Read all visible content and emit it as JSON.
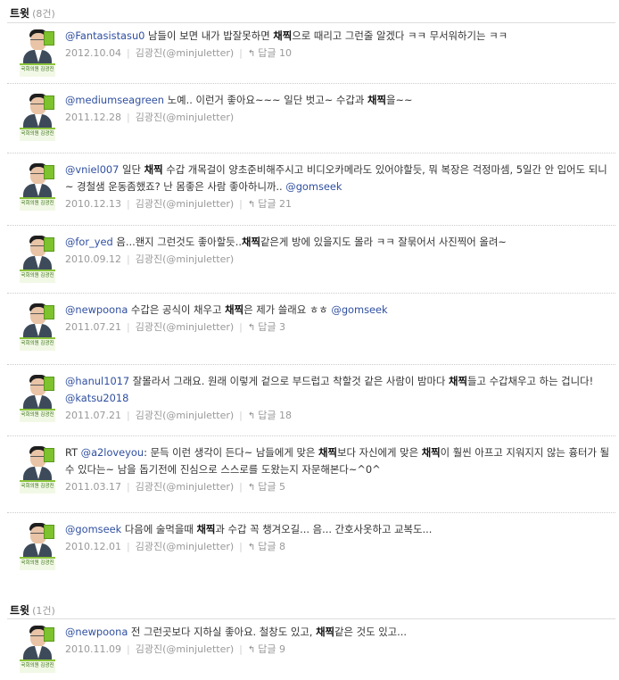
{
  "sections": [
    {
      "title": "트윗",
      "count": "(8건)",
      "tweets": [
        {
          "pre": "",
          "mention": "@Fantasistasu0",
          "p1": " 남들이 보면 내가 밥잘못하면 ",
          "kw1": "채찍",
          "p2": "으로 때리고 그런줄 알겠다 ㅋㅋ 무서워하기는 ㅋㅋ",
          "kw2": "",
          "p3": "",
          "mention2": "",
          "date": "2012.10.04",
          "author": "김광진(@minjuletter)",
          "reply": "답글 10"
        },
        {
          "pre": "",
          "mention": "@mediumseagreen",
          "p1": " 노예.. 이런거 좋아요~~~ 일단 벗고~ 수갑과 ",
          "kw1": "채찍",
          "p2": "을~~",
          "kw2": "",
          "p3": "",
          "mention2": "",
          "date": "2011.12.28",
          "author": "김광진(@minjuletter)",
          "reply": ""
        },
        {
          "pre": "",
          "mention": "@vniel007",
          "p1": " 일단 ",
          "kw1": "채찍",
          "p2": " 수갑 개목걸이 양초준비해주시고 비디오카메라도 있어야할듯, 뭐 복장은 걱정마셈, 5일간 안 입어도 되니~ 경철샘 운동좀했죠? 난 몸좋은 사람 좋아하니까.. ",
          "kw2": "",
          "p3": "",
          "mention2": "@gomseek",
          "date": "2010.12.13",
          "author": "김광진(@minjuletter)",
          "reply": "답글 21"
        },
        {
          "pre": "",
          "mention": "@for_yed",
          "p1": " 음...왠지 그런것도 좋아할듯..",
          "kw1": "채찍",
          "p2": "같은게 방에 있을지도 몰라 ㅋㅋ 잘묶어서 사진찍어 올려~",
          "kw2": "",
          "p3": "",
          "mention2": "",
          "date": "2010.09.12",
          "author": "김광진(@minjuletter)",
          "reply": ""
        },
        {
          "pre": "",
          "mention": "@newpoona",
          "p1": " 수갑은 공식이 채우고 ",
          "kw1": "채찍",
          "p2": "은 제가 쓸래요 ㅎㅎ ",
          "kw2": "",
          "p3": "",
          "mention2": "@gomseek",
          "date": "2011.07.21",
          "author": "김광진(@minjuletter)",
          "reply": "답글 3"
        },
        {
          "pre": "",
          "mention": "@hanul1017",
          "p1": " 잘몰라서 그래요. 원래 이렇게 겉으로 부드럽고 착할것 같은 사람이 밤마다 ",
          "kw1": "채찍",
          "p2": "들고 수갑채우고 하는 겁니다! ",
          "kw2": "",
          "p3": "",
          "mention2": "@katsu2018",
          "date": "2011.07.21",
          "author": "김광진(@minjuletter)",
          "reply": "답글 18"
        },
        {
          "pre": "RT ",
          "mention": "@a2loveyou",
          "p1": ": 문득 이런 생각이 든다~ 남들에게 맞은 ",
          "kw1": "채찍",
          "p2": "보다 자신에게 맞은 ",
          "kw2": "채찍",
          "p3": "이 훨씬 아프고 지워지지 않는 흉터가 될 수 있다는~ 남을 돕기전에 진심으로 스스로를 도왔는지 자문해본다~^0^",
          "mention2": "",
          "date": "2011.03.17",
          "author": "김광진(@minjuletter)",
          "reply": "답글 5"
        },
        {
          "pre": "",
          "mention": "@gomseek",
          "p1": " 다음에 술먹을때 ",
          "kw1": "채찍",
          "p2": "과 수갑 꼭 챙겨오길... 음... 간호사옷하고 교복도...",
          "kw2": "",
          "p3": "",
          "mention2": "",
          "date": "2010.12.01",
          "author": "김광진(@minjuletter)",
          "reply": "답글 8"
        }
      ]
    },
    {
      "title": "트윗",
      "count": "(1건)",
      "tweets": [
        {
          "pre": "",
          "mention": "@newpoona",
          "p1": " 전 그런곳보다 지하실 좋아요. 철창도 있고, ",
          "kw1": "채찍",
          "p2": "같은 것도 있고...",
          "kw2": "",
          "p3": "",
          "mention2": "",
          "date": "2010.11.09",
          "author": "김광진(@minjuletter)",
          "reply": "답글 9"
        }
      ]
    }
  ],
  "avatar_banner": "국회의원 김광진",
  "icons": {
    "reply": "reply-arrow-icon"
  },
  "colors": {
    "link": "#2f4fa0",
    "keyword": "#111111",
    "meta": "#999999",
    "banner_green": "#8ac33a"
  }
}
